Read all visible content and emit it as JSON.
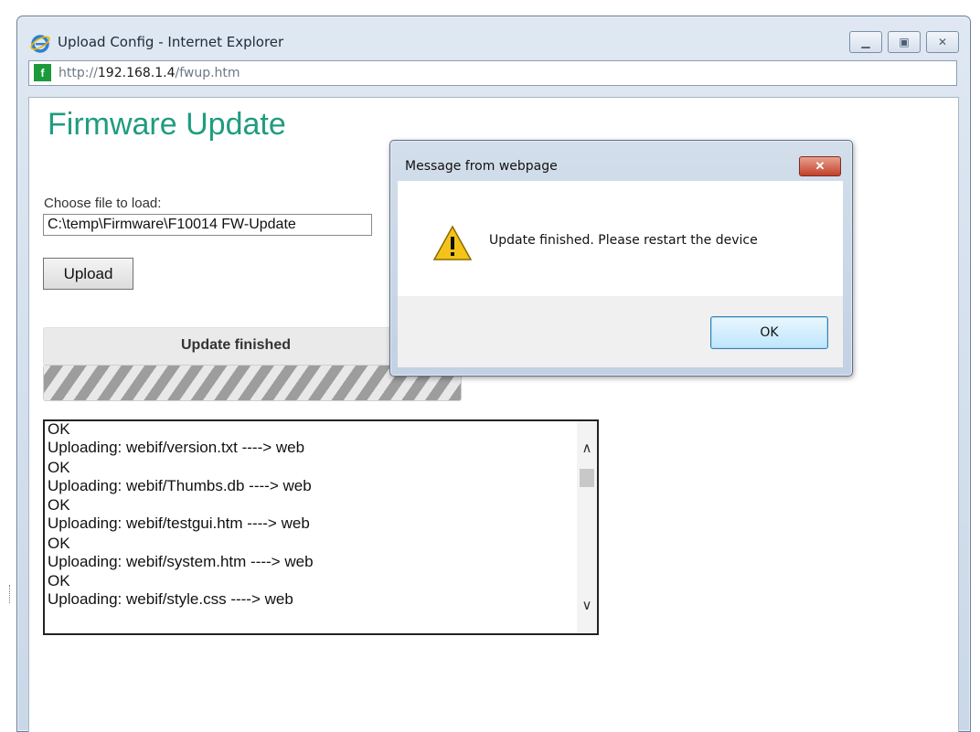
{
  "window": {
    "title": "Upload Config - Internet Explorer",
    "url_prefix": "http://",
    "url_host": "192.168.1.4",
    "url_path": "/fwup.htm",
    "minimize_icon": "minimize-icon",
    "maximize_icon": "maximize-icon",
    "close_icon": "close-icon"
  },
  "page": {
    "title": "Firmware Update",
    "file_label": "Choose file to load:",
    "file_value": "C:\\temp\\Firmware\\F10014 FW-Update",
    "upload_label": "Upload",
    "status_text": "Update finished",
    "progress_fraction": 1.0,
    "log_lines": [
      "OK",
      "Uploading: webif/version.txt ----> web",
      "OK",
      "Uploading: webif/Thumbs.db ----> web",
      "OK",
      "Uploading: webif/testgui.htm ----> web",
      "OK",
      "Uploading: webif/system.htm ----> web",
      "OK",
      "Uploading: webif/style.css ----> web"
    ],
    "scroll_up_icon": "chevron-up-icon",
    "scroll_down_icon": "chevron-down-icon"
  },
  "dialog": {
    "title": "Message from webpage",
    "close_glyph": "✕",
    "icon": "warning-icon",
    "message": "Update finished. Please restart the device",
    "ok_label": "OK"
  },
  "colors": {
    "title_green": "#1f9c80",
    "ok_button_blue": "#bee6fd",
    "close_red": "#c2412a"
  }
}
